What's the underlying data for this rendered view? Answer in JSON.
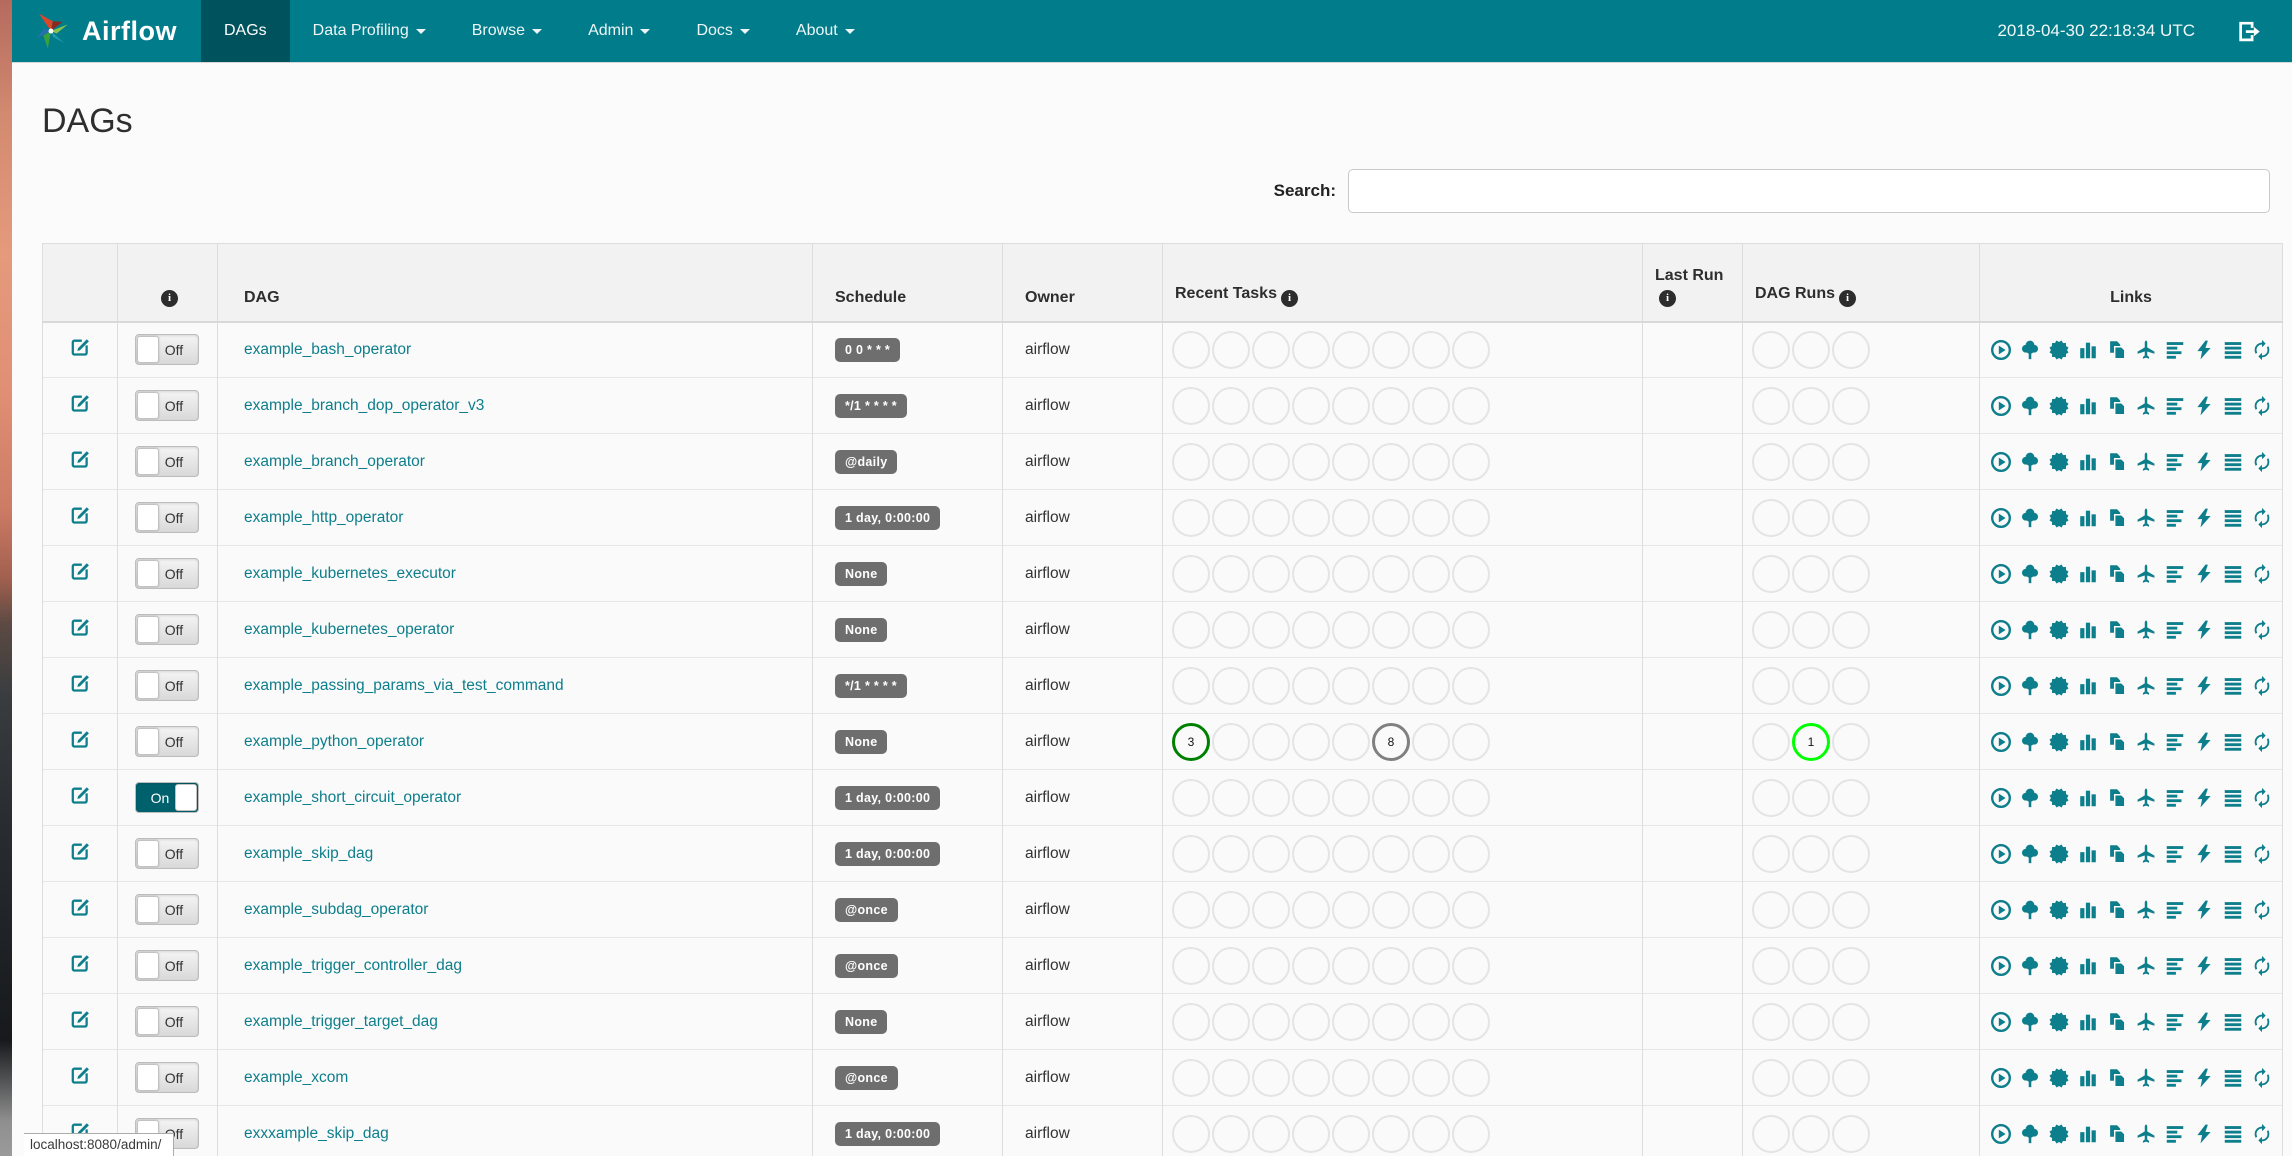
{
  "navbar": {
    "brand": "Airflow",
    "items": [
      {
        "label": "DAGs",
        "active": true,
        "caret": false
      },
      {
        "label": "Data Profiling",
        "active": false,
        "caret": true
      },
      {
        "label": "Browse",
        "active": false,
        "caret": true
      },
      {
        "label": "Admin",
        "active": false,
        "caret": true
      },
      {
        "label": "Docs",
        "active": false,
        "caret": true
      },
      {
        "label": "About",
        "active": false,
        "caret": true
      }
    ],
    "clock": "2018-04-30 22:18:34 UTC",
    "logout_icon": "sign-out-icon"
  },
  "page": {
    "title": "DAGs"
  },
  "search": {
    "label": "Search:",
    "value": ""
  },
  "table": {
    "columns": [
      {
        "label": "",
        "info": false
      },
      {
        "label": "",
        "info": true
      },
      {
        "label": "DAG",
        "info": false
      },
      {
        "label": "Schedule",
        "info": false
      },
      {
        "label": "Owner",
        "info": false
      },
      {
        "label": "Recent Tasks",
        "info": true
      },
      {
        "label": "Last Run",
        "info": true
      },
      {
        "label": "DAG Runs",
        "info": true
      },
      {
        "label": "Links",
        "info": false
      }
    ],
    "recent_task_slots": 8,
    "dag_run_slots": 3,
    "rows": [
      {
        "name": "example_bash_operator",
        "toggle": "Off",
        "schedule": "0 0 * * *",
        "owner": "airflow",
        "last_run": "",
        "recent_tasks": [],
        "dag_runs": []
      },
      {
        "name": "example_branch_dop_operator_v3",
        "toggle": "Off",
        "schedule": "*/1 * * * *",
        "owner": "airflow",
        "last_run": "",
        "recent_tasks": [],
        "dag_runs": []
      },
      {
        "name": "example_branch_operator",
        "toggle": "Off",
        "schedule": "@daily",
        "owner": "airflow",
        "last_run": "",
        "recent_tasks": [],
        "dag_runs": []
      },
      {
        "name": "example_http_operator",
        "toggle": "Off",
        "schedule": "1 day, 0:00:00",
        "owner": "airflow",
        "last_run": "",
        "recent_tasks": [],
        "dag_runs": []
      },
      {
        "name": "example_kubernetes_executor",
        "toggle": "Off",
        "schedule": "None",
        "owner": "airflow",
        "last_run": "",
        "recent_tasks": [],
        "dag_runs": []
      },
      {
        "name": "example_kubernetes_operator",
        "toggle": "Off",
        "schedule": "None",
        "owner": "airflow",
        "last_run": "",
        "recent_tasks": [],
        "dag_runs": []
      },
      {
        "name": "example_passing_params_via_test_command",
        "toggle": "Off",
        "schedule": "*/1 * * * *",
        "owner": "airflow",
        "last_run": "",
        "recent_tasks": [],
        "dag_runs": []
      },
      {
        "name": "example_python_operator",
        "toggle": "Off",
        "schedule": "None",
        "owner": "airflow",
        "last_run": "",
        "recent_tasks": [
          {
            "slot": 0,
            "count": 3,
            "color": "#008000"
          },
          {
            "slot": 5,
            "count": 8,
            "color": "#808080"
          }
        ],
        "dag_runs": [
          {
            "slot": 1,
            "count": 1,
            "color": "#00ff00"
          }
        ]
      },
      {
        "name": "example_short_circuit_operator",
        "toggle": "On",
        "schedule": "1 day, 0:00:00",
        "owner": "airflow",
        "last_run": "",
        "recent_tasks": [],
        "dag_runs": []
      },
      {
        "name": "example_skip_dag",
        "toggle": "Off",
        "schedule": "1 day, 0:00:00",
        "owner": "airflow",
        "last_run": "",
        "recent_tasks": [],
        "dag_runs": []
      },
      {
        "name": "example_subdag_operator",
        "toggle": "Off",
        "schedule": "@once",
        "owner": "airflow",
        "last_run": "",
        "recent_tasks": [],
        "dag_runs": []
      },
      {
        "name": "example_trigger_controller_dag",
        "toggle": "Off",
        "schedule": "@once",
        "owner": "airflow",
        "last_run": "",
        "recent_tasks": [],
        "dag_runs": []
      },
      {
        "name": "example_trigger_target_dag",
        "toggle": "Off",
        "schedule": "None",
        "owner": "airflow",
        "last_run": "",
        "recent_tasks": [],
        "dag_runs": []
      },
      {
        "name": "example_xcom",
        "toggle": "Off",
        "schedule": "@once",
        "owner": "airflow",
        "last_run": "",
        "recent_tasks": [],
        "dag_runs": []
      },
      {
        "name": "exxxample_skip_dag",
        "toggle": "Off",
        "schedule": "1 day, 0:00:00",
        "owner": "airflow",
        "last_run": "",
        "recent_tasks": [],
        "dag_runs": []
      }
    ]
  },
  "links": {
    "icons": [
      {
        "name": "trigger-dag-icon",
        "title": "Trigger Dag",
        "sym": "i-trigger"
      },
      {
        "name": "tree-view-icon",
        "title": "Tree View",
        "sym": "i-tree"
      },
      {
        "name": "graph-view-icon",
        "title": "Graph View",
        "sym": "i-graph"
      },
      {
        "name": "task-duration-icon",
        "title": "Task Duration",
        "sym": "i-duration"
      },
      {
        "name": "task-tries-icon",
        "title": "Task Tries",
        "sym": "i-tries"
      },
      {
        "name": "landing-times-icon",
        "title": "Landing Times",
        "sym": "i-plane"
      },
      {
        "name": "gantt-icon",
        "title": "Gantt View",
        "sym": "i-gantt"
      },
      {
        "name": "code-view-icon",
        "title": "Code View",
        "sym": "i-code"
      },
      {
        "name": "logs-icon",
        "title": "Logs",
        "sym": "i-logs"
      },
      {
        "name": "refresh-icon",
        "title": "Refresh",
        "sym": "i-refresh"
      }
    ]
  },
  "status_bar": {
    "url": "localhost:8080/admin/"
  },
  "colors": {
    "navbar": "#007c8a",
    "navbar_active": "#00525d",
    "accent_link": "#0d7e8b",
    "schedule_badge": "#6e6e6e",
    "task_success": "#008000",
    "task_queued": "#808080",
    "dagrun_running": "#00ff00",
    "circle_empty": "#e4e4e4"
  }
}
